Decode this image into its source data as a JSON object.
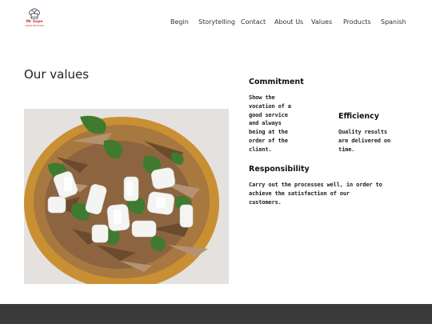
{
  "logo": {
    "name": "Mr Sope",
    "tagline": "SABOR MEXICANO"
  },
  "nav": {
    "items": [
      {
        "label": "Begin",
        "name": "nav-begin"
      },
      {
        "label": "Storytelling",
        "name": "nav-storytelling"
      },
      {
        "label": "Contact",
        "name": "nav-contact"
      },
      {
        "label": "About Us",
        "name": "nav-about-us"
      },
      {
        "label": "Values",
        "name": "nav-values"
      },
      {
        "label": "Products",
        "name": "nav-products"
      },
      {
        "label": "Spanish",
        "name": "nav-spanish"
      }
    ]
  },
  "main": {
    "title": "Our values",
    "image_alt": "Sope with shredded meat, onion and cilantro"
  },
  "values": {
    "commitment": {
      "title": "Commitment",
      "body": "Show the vocation of a good service and always being at the order of the client."
    },
    "efficiency": {
      "title": "Efficiency",
      "body": "Quality results are delivered on time."
    },
    "responsibility": {
      "title": "Responsibility",
      "body": "Carry out the processes well, in order to achieve the satisfaction of our customers."
    }
  },
  "colors": {
    "footer": "#3a3a3a",
    "brand": "#c0392b"
  }
}
